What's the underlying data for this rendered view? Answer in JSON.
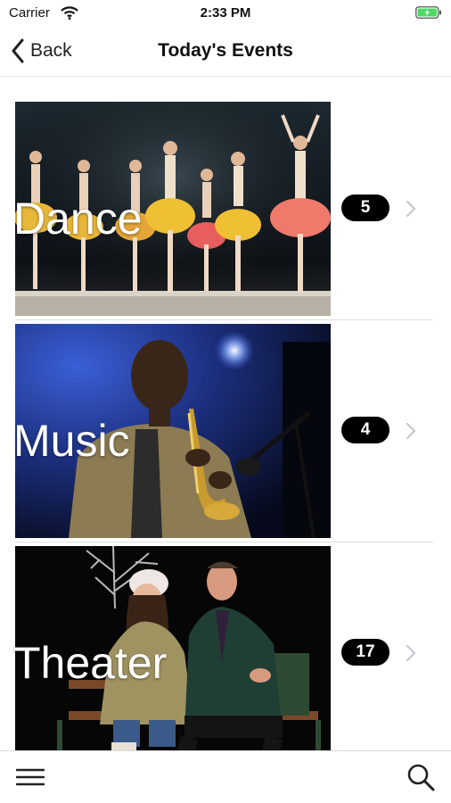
{
  "status_bar": {
    "carrier": "Carrier",
    "time": "2:33 PM",
    "icons": [
      "wifi-icon",
      "battery-charging-icon"
    ],
    "battery_color": "#4cd964"
  },
  "nav": {
    "back_label": "Back",
    "title": "Today's Events"
  },
  "events": [
    {
      "category": "Dance",
      "count": "5",
      "image": "ballet-dancers-photo"
    },
    {
      "category": "Music",
      "count": "4",
      "image": "saxophone-player-photo"
    },
    {
      "category": "Theater",
      "count": "17",
      "image": "actors-on-bench-photo"
    }
  ],
  "tab_bar": {
    "icons": [
      "hamburger-menu-icon",
      "search-icon"
    ]
  },
  "colors": {
    "badge_background": "#000000",
    "badge_text": "#ffffff",
    "chevron": "#c7c7cc"
  }
}
